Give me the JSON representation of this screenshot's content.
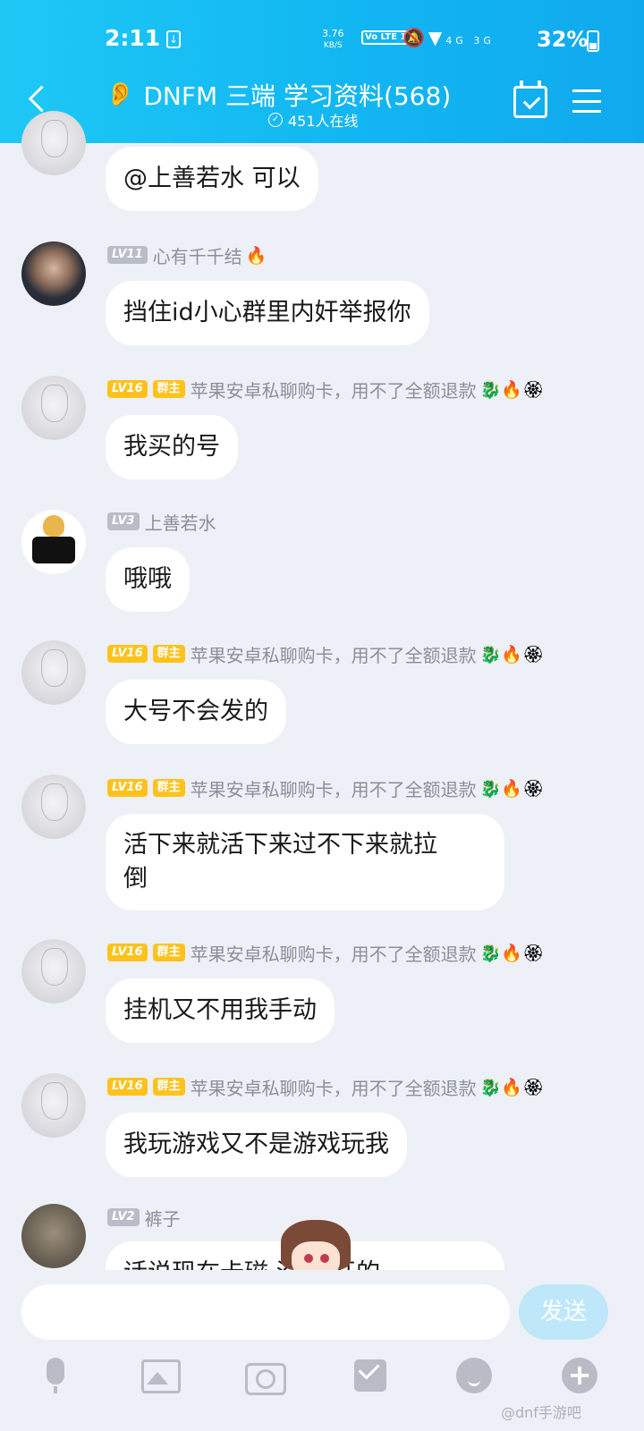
{
  "status_bar": {
    "time": "2:11",
    "net_speed_value": "3.76",
    "net_speed_unit": "KB/S",
    "volte_label": "Vo LTE 1",
    "signal_labels": "4G 3G",
    "battery": "32%"
  },
  "header": {
    "title": "DNFM 三端 学习资料(568)",
    "online": "451人在线"
  },
  "messages": [
    {
      "text": "@上善若水 可以"
    },
    {
      "level": "LV11",
      "nick": "心有千千结",
      "badges": "🔥",
      "text": "挡住id小心群里内奸举报你"
    },
    {
      "level": "LV16",
      "role": "群主",
      "nick": "苹果安卓私聊购卡，用不了全额退款",
      "badges": "🐉🔥🏵",
      "text": "我买的号"
    },
    {
      "level": "LV3",
      "nick": "上善若水",
      "text": "哦哦"
    },
    {
      "level": "LV16",
      "role": "群主",
      "nick": "苹果安卓私聊购卡，用不了全额退款",
      "badges": "🐉🔥🏵",
      "text": "大号不会发的"
    },
    {
      "level": "LV16",
      "role": "群主",
      "nick": "苹果安卓私聊购卡，用不了全额退款",
      "badges": "🐉🔥🏵",
      "text_line1": "活下来就活下来过不下来就拉",
      "text_line2": "倒"
    },
    {
      "level": "LV16",
      "role": "群主",
      "nick": "苹果安卓私聊购卡，用不了全额退款",
      "badges": "🐉🔥🏵",
      "text": "挂机又不用我手动"
    },
    {
      "level": "LV16",
      "role": "群主",
      "nick": "苹果安卓私聊购卡，用不了全额退款",
      "badges": "🐉🔥🏵",
      "text": "我玩游戏又不是游戏玩我"
    },
    {
      "level": "LV2",
      "nick": "裤子",
      "text": "话说现在卡磁 没 没开的"
    }
  ],
  "input": {
    "placeholder": "",
    "send_label": "发送"
  },
  "watermark": "@dnf手游吧"
}
